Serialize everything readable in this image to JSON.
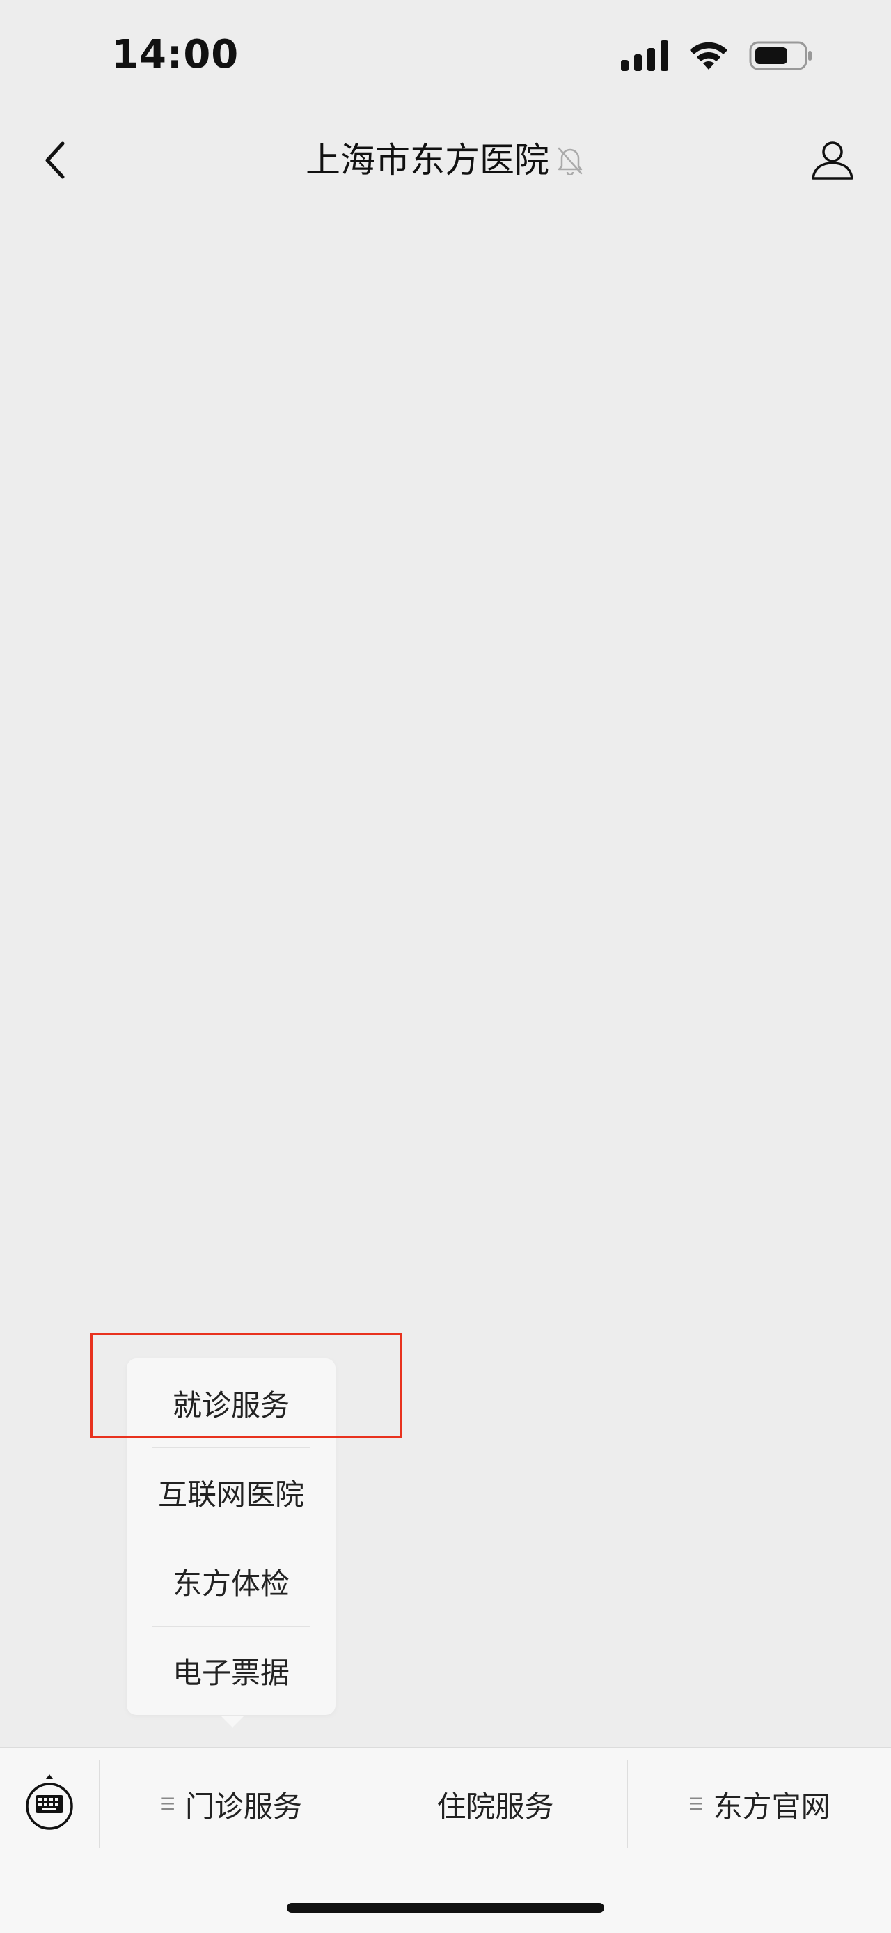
{
  "status_bar": {
    "time": "14:00",
    "icons": [
      "cellular-signal-icon",
      "wifi-icon",
      "battery-icon"
    ]
  },
  "nav": {
    "title": "上海市东方医院",
    "icons": {
      "back": "chevron-left-icon",
      "mute": "bell-muted-icon",
      "profile": "person-icon"
    }
  },
  "popup_menu": {
    "items": [
      {
        "label": "就诊服务"
      },
      {
        "label": "互联网医院"
      },
      {
        "label": "东方体检"
      },
      {
        "label": "电子票据"
      }
    ]
  },
  "bottom_menu": {
    "keyboard_icon": "keyboard-icon",
    "tabs": [
      {
        "label": "门诊服务",
        "has_submenu": true
      },
      {
        "label": "住院服务",
        "has_submenu": false
      },
      {
        "label": "东方官网",
        "has_submenu": true
      }
    ]
  },
  "colors": {
    "background": "#ededed",
    "bar": "#f7f7f7",
    "highlight": "#e8321e"
  }
}
